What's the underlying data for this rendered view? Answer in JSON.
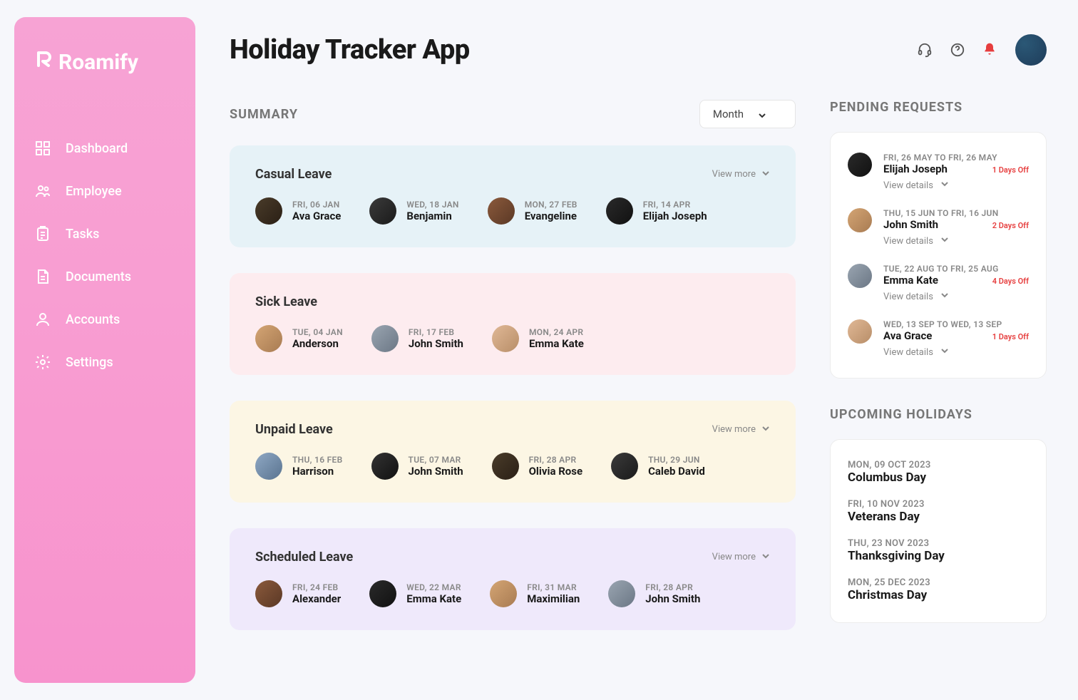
{
  "brand": "Roamify",
  "nav": {
    "items": [
      {
        "label": "Dashboard"
      },
      {
        "label": "Employee"
      },
      {
        "label": "Tasks"
      },
      {
        "label": "Documents"
      },
      {
        "label": "Accounts"
      },
      {
        "label": "Settings"
      }
    ]
  },
  "page": {
    "title": "Holiday Tracker App"
  },
  "summary": {
    "label": "SUMMARY",
    "filter_selected": "Month",
    "view_more_label": "View more",
    "cards": [
      {
        "title": "Casual Leave",
        "show_view_more": true,
        "entries": [
          {
            "date": "FRI, 06 JAN",
            "name": "Ava Grace"
          },
          {
            "date": "WED, 18 JAN",
            "name": "Benjamin"
          },
          {
            "date": "MON, 27 FEB",
            "name": "Evangeline"
          },
          {
            "date": "FRI, 14 APR",
            "name": "Elijah Joseph"
          }
        ]
      },
      {
        "title": "Sick Leave",
        "show_view_more": false,
        "entries": [
          {
            "date": "TUE, 04 JAN",
            "name": "Anderson"
          },
          {
            "date": "FRI, 17 FEB",
            "name": "John Smith"
          },
          {
            "date": "MON, 24 APR",
            "name": "Emma Kate"
          }
        ]
      },
      {
        "title": "Unpaid Leave",
        "show_view_more": true,
        "entries": [
          {
            "date": "THU, 16 FEB",
            "name": "Harrison"
          },
          {
            "date": "TUE, 07 MAR",
            "name": "John Smith"
          },
          {
            "date": "FRI, 28 APR",
            "name": "Olivia Rose"
          },
          {
            "date": "THU, 29 JUN",
            "name": "Caleb David"
          }
        ]
      },
      {
        "title": "Scheduled Leave",
        "show_view_more": true,
        "entries": [
          {
            "date": "FRI, 24 FEB",
            "name": "Alexander"
          },
          {
            "date": "WED, 22 MAR",
            "name": "Emma Kate"
          },
          {
            "date": "FRI, 31 MAR",
            "name": "Maximilian"
          },
          {
            "date": "FRI, 28 APR",
            "name": "John Smith"
          }
        ]
      }
    ]
  },
  "pending": {
    "label": "PENDING REQUESTS",
    "view_details_label": "View details",
    "items": [
      {
        "dates": "FRI, 26 MAY TO FRI, 26 MAY",
        "name": "Elijah Joseph",
        "days_off": "1 Days Off"
      },
      {
        "dates": "THU, 15 JUN TO FRI, 16 JUN",
        "name": "John Smith",
        "days_off": "2 Days Off"
      },
      {
        "dates": "TUE, 22 AUG TO FRI, 25 AUG",
        "name": "Emma Kate",
        "days_off": "4 Days Off"
      },
      {
        "dates": "WED, 13 SEP TO WED, 13 SEP",
        "name": "Ava Grace",
        "days_off": "1 Days Off"
      }
    ]
  },
  "holidays": {
    "label": "UPCOMING HOLIDAYS",
    "items": [
      {
        "date": "MON, 09 OCT 2023",
        "name": "Columbus Day"
      },
      {
        "date": "FRI, 10 NOV 2023",
        "name": "Veterans Day"
      },
      {
        "date": "THU, 23 NOV 2023",
        "name": "Thanksgiving Day"
      },
      {
        "date": "MON, 25 DEC 2023",
        "name": "Christmas Day"
      }
    ]
  }
}
